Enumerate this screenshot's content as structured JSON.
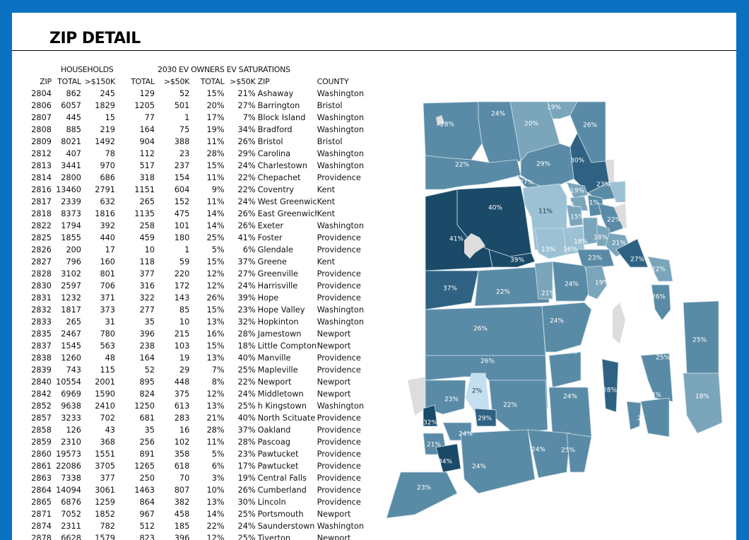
{
  "title": "ZIP DETAIL",
  "group_headers": {
    "households": "HOUSEHOLDS",
    "ev_owners": "2030 EV OWNERS",
    "ev_saturations": "EV SATURATIONS"
  },
  "columns": [
    "ZIP",
    "TOTAL",
    ">$150K",
    "TOTAL",
    ">$50K",
    "TOTAL",
    ">$50K",
    "ZIP",
    "COUNTY"
  ],
  "rows": [
    [
      "2804",
      "862",
      "245",
      "129",
      "52",
      "15%",
      "21%",
      "Ashaway",
      "Washington"
    ],
    [
      "2806",
      "6057",
      "1829",
      "1205",
      "501",
      "20%",
      "27%",
      "Barrington",
      "Bristol"
    ],
    [
      "2807",
      "445",
      "15",
      "77",
      "1",
      "17%",
      "7%",
      "Block Island",
      "Washington"
    ],
    [
      "2808",
      "885",
      "219",
      "164",
      "75",
      "19%",
      "34%",
      "Bradford",
      "Washington"
    ],
    [
      "2809",
      "8021",
      "1492",
      "904",
      "388",
      "11%",
      "26%",
      "Bristol",
      "Bristol"
    ],
    [
      "2812",
      "407",
      "78",
      "112",
      "23",
      "28%",
      "29%",
      "Carolina",
      "Washington"
    ],
    [
      "2813",
      "3441",
      "970",
      "517",
      "237",
      "15%",
      "24%",
      "Charlestown",
      "Washington"
    ],
    [
      "2814",
      "2800",
      "686",
      "318",
      "154",
      "11%",
      "22%",
      "Chepachet",
      "Providence"
    ],
    [
      "2816",
      "13460",
      "2791",
      "1151",
      "604",
      "9%",
      "22%",
      "Coventry",
      "Kent"
    ],
    [
      "2817",
      "2339",
      "632",
      "265",
      "152",
      "11%",
      "24%",
      "West Greenwich",
      "Kent"
    ],
    [
      "2818",
      "8373",
      "1816",
      "1135",
      "475",
      "14%",
      "26%",
      "East Greenwich",
      "Kent"
    ],
    [
      "2822",
      "1794",
      "392",
      "258",
      "101",
      "14%",
      "26%",
      "Exeter",
      "Washington"
    ],
    [
      "2825",
      "1855",
      "440",
      "459",
      "180",
      "25%",
      "41%",
      "Foster",
      "Providence"
    ],
    [
      "2826",
      "200",
      "17",
      "10",
      "1",
      "5%",
      "6%",
      "Glendale",
      "Providence"
    ],
    [
      "2827",
      "796",
      "160",
      "118",
      "59",
      "15%",
      "37%",
      "Greene",
      "Kent"
    ],
    [
      "2828",
      "3102",
      "801",
      "377",
      "220",
      "12%",
      "27%",
      "Greenville",
      "Providence"
    ],
    [
      "2830",
      "2597",
      "706",
      "316",
      "172",
      "12%",
      "24%",
      "Harrisville",
      "Providence"
    ],
    [
      "2831",
      "1232",
      "371",
      "322",
      "143",
      "26%",
      "39%",
      "Hope",
      "Providence"
    ],
    [
      "2832",
      "1817",
      "373",
      "277",
      "85",
      "15%",
      "23%",
      "Hope Valley",
      "Washington"
    ],
    [
      "2833",
      "265",
      "31",
      "35",
      "10",
      "13%",
      "32%",
      "Hopkinton",
      "Washington"
    ],
    [
      "2835",
      "2467",
      "780",
      "396",
      "215",
      "16%",
      "28%",
      "Jamestown",
      "Newport"
    ],
    [
      "2837",
      "1545",
      "563",
      "238",
      "103",
      "15%",
      "18%",
      "Little Compton",
      "Newport"
    ],
    [
      "2838",
      "1260",
      "48",
      "164",
      "19",
      "13%",
      "40%",
      "Manville",
      "Providence"
    ],
    [
      "2839",
      "743",
      "115",
      "52",
      "29",
      "7%",
      "25%",
      "Mapleville",
      "Providence"
    ],
    [
      "2840",
      "10554",
      "2001",
      "895",
      "448",
      "8%",
      "22%",
      "Newport",
      "Newport"
    ],
    [
      "2842",
      "6969",
      "1590",
      "824",
      "375",
      "12%",
      "24%",
      "Middletown",
      "Newport"
    ],
    [
      "2852",
      "9638",
      "2410",
      "1250",
      "613",
      "13%",
      "25%",
      "h Kingstown",
      "Washington"
    ],
    [
      "2857",
      "3233",
      "702",
      "681",
      "283",
      "21%",
      "40%",
      "North Scituate",
      "Providence"
    ],
    [
      "2858",
      "126",
      "43",
      "35",
      "16",
      "28%",
      "37%",
      "Oakland",
      "Providence"
    ],
    [
      "2859",
      "2310",
      "368",
      "256",
      "102",
      "11%",
      "28%",
      "Pascoag",
      "Providence"
    ],
    [
      "2860",
      "19573",
      "1551",
      "891",
      "358",
      "5%",
      "23%",
      "Pawtucket",
      "Providence"
    ],
    [
      "2861",
      "22086",
      "3705",
      "1265",
      "618",
      "6%",
      "17%",
      "Pawtucket",
      "Providence"
    ],
    [
      "2863",
      "7338",
      "377",
      "250",
      "70",
      "3%",
      "19%",
      "Central Falls",
      "Providence"
    ],
    [
      "2864",
      "14094",
      "3061",
      "1463",
      "807",
      "10%",
      "26%",
      "Cumberland",
      "Providence"
    ],
    [
      "2865",
      "6876",
      "1259",
      "864",
      "382",
      "13%",
      "30%",
      "Lincoln",
      "Providence"
    ],
    [
      "2871",
      "7052",
      "1852",
      "967",
      "458",
      "14%",
      "25%",
      "Portsmouth",
      "Newport"
    ],
    [
      "2874",
      "2311",
      "782",
      "512",
      "185",
      "22%",
      "24%",
      "Saunderstown",
      "Washington"
    ],
    [
      "2878",
      "6628",
      "1579",
      "823",
      "396",
      "12%",
      "25%",
      "Tiverton",
      "Newport"
    ]
  ],
  "map": {
    "colors": {
      "dark": "#1b4a68",
      "darkmid": "#2f6282",
      "mid": "#5a8ba6",
      "midlight": "#7aa5bb",
      "light": "#9dc1d4",
      "palest": "#c3dff0",
      "gray": "#dddddd",
      "border": "#cfe0ea"
    },
    "regions": [
      {
        "label": "28%"
      },
      {
        "label": "24%"
      },
      {
        "label": "20%"
      },
      {
        "label": "19%"
      },
      {
        "label": "26%"
      },
      {
        "label": "22%"
      },
      {
        "label": "29%"
      },
      {
        "label": "30%"
      },
      {
        "label": "27%"
      },
      {
        "label": "23%"
      },
      {
        "label": "1..."
      },
      {
        "label": "40%"
      },
      {
        "label": "41%"
      },
      {
        "label": "39%"
      },
      {
        "label": "11%"
      },
      {
        "label": "19%"
      },
      {
        "label": "1..."
      },
      {
        "label": "21%"
      },
      {
        "label": "15%"
      },
      {
        "label": "22%"
      },
      {
        "label": "18%"
      },
      {
        "label": "18%"
      },
      {
        "label": "16%"
      },
      {
        "label": "13%"
      },
      {
        "label": "21%"
      },
      {
        "label": "23%"
      },
      {
        "label": "27%"
      },
      {
        "label": "37%"
      },
      {
        "label": "22%"
      },
      {
        "label": "21%"
      },
      {
        "label": "24%"
      },
      {
        "label": "19%"
      },
      {
        "label": "22%"
      },
      {
        "label": "26%"
      },
      {
        "label": "24%"
      },
      {
        "label": "26%"
      },
      {
        "label": "25%"
      },
      {
        "label": "25%"
      },
      {
        "label": "25%"
      },
      {
        "label": "26%"
      },
      {
        "label": "2%"
      },
      {
        "label": "23%"
      },
      {
        "label": "22%"
      },
      {
        "label": "28%"
      },
      {
        "label": "24%"
      },
      {
        "label": "24%"
      },
      {
        "label": "18%"
      },
      {
        "label": "32%"
      },
      {
        "label": "29%"
      },
      {
        "label": "24%"
      },
      {
        "label": "2."
      },
      {
        "label": "21%"
      },
      {
        "label": "34%"
      },
      {
        "label": "24%"
      },
      {
        "label": "24%"
      },
      {
        "label": "25%"
      },
      {
        "label": "23%"
      }
    ]
  }
}
